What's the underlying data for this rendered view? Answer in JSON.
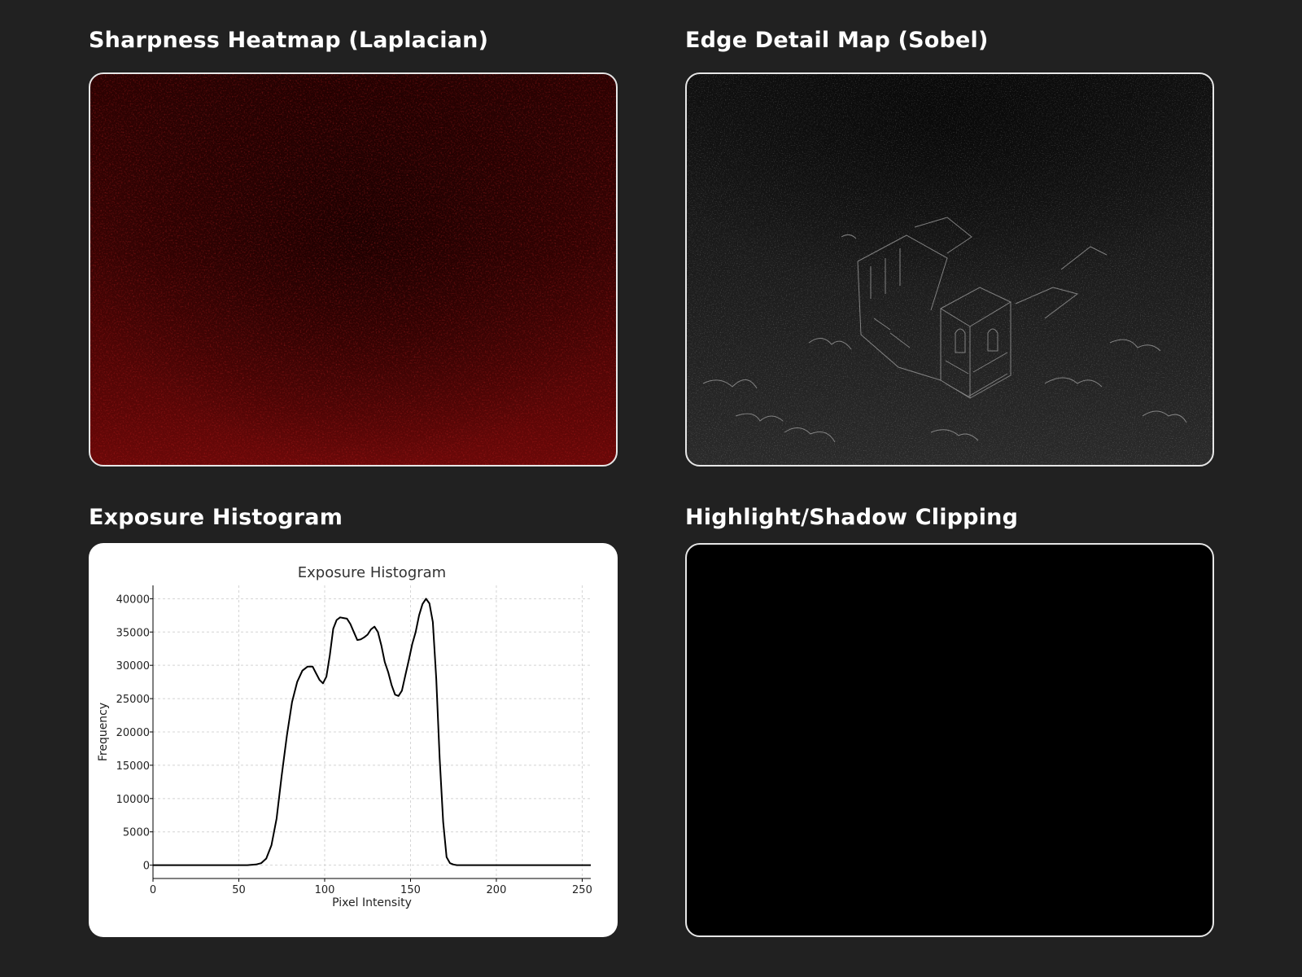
{
  "panels": {
    "sharpness": {
      "title": "Sharpness Heatmap (Laplacian)"
    },
    "edges": {
      "title": "Edge Detail Map (Sobel)"
    },
    "exposure": {
      "title": "Exposure Histogram"
    },
    "clipping": {
      "title": "Highlight/Shadow Clipping"
    }
  },
  "colors": {
    "background": "#212121",
    "heatmap": "#8b0000",
    "edge": "#bdbdbd",
    "histogram_line": "#000000"
  },
  "chart_data": {
    "type": "line",
    "title": "Exposure Histogram",
    "xlabel": "Pixel Intensity",
    "ylabel": "Frequency",
    "xlim": [
      0,
      255
    ],
    "ylim": [
      -2000,
      42000
    ],
    "grid": true,
    "xticks": [
      0,
      50,
      100,
      150,
      200,
      250
    ],
    "yticks": [
      0,
      5000,
      10000,
      15000,
      20000,
      25000,
      30000,
      35000,
      40000
    ],
    "series": [
      {
        "x": [
          0,
          50,
          55,
          60,
          63,
          66,
          69,
          72,
          75,
          78,
          81,
          84,
          87,
          90,
          93,
          95,
          97,
          99,
          101,
          103,
          105,
          107,
          109,
          111,
          113,
          115,
          117,
          119,
          121,
          123,
          125,
          127,
          129,
          131,
          133,
          135,
          137,
          139,
          141,
          143,
          145,
          147,
          149,
          151,
          153,
          155,
          157,
          159,
          161,
          163,
          165,
          167,
          169,
          171,
          173,
          175,
          177,
          179,
          181,
          183,
          186,
          190,
          200,
          255
        ],
        "values": [
          0,
          0,
          0,
          100,
          300,
          1000,
          3000,
          7000,
          13500,
          19500,
          24500,
          27500,
          29200,
          29800,
          29800,
          28800,
          27800,
          27300,
          28300,
          31500,
          35500,
          36800,
          37200,
          37100,
          37000,
          36200,
          35000,
          33800,
          33900,
          34200,
          34600,
          35400,
          35800,
          35000,
          33000,
          30500,
          29000,
          27000,
          25600,
          25400,
          26200,
          28500,
          30800,
          33200,
          35000,
          37500,
          39200,
          40000,
          39300,
          36500,
          28000,
          16000,
          6500,
          1200,
          300,
          100,
          0,
          0,
          0,
          0,
          0,
          0,
          0,
          0
        ]
      }
    ]
  }
}
